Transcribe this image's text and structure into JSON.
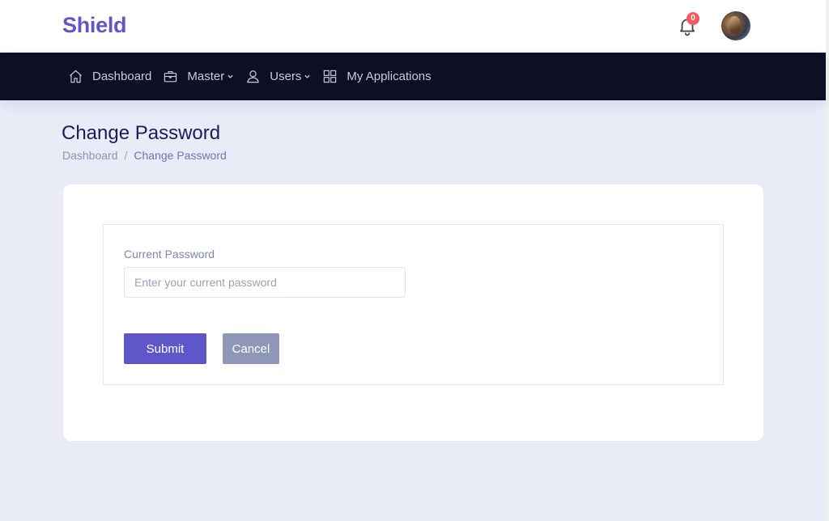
{
  "header": {
    "brand": "Shield",
    "notification_count": "0"
  },
  "nav": {
    "items": [
      {
        "label": "Dashboard",
        "icon": "home-icon",
        "has_dropdown": false
      },
      {
        "label": "Master",
        "icon": "briefcase-icon",
        "has_dropdown": true
      },
      {
        "label": "Users",
        "icon": "user-icon",
        "has_dropdown": true
      },
      {
        "label": "My Applications",
        "icon": "grid-icon",
        "has_dropdown": false
      }
    ]
  },
  "page": {
    "title": "Change Password",
    "breadcrumb": {
      "root": "Dashboard",
      "separator": "/",
      "current": "Change Password"
    }
  },
  "form": {
    "current_password_label": "Current Password",
    "current_password_placeholder": "Enter your current password",
    "current_password_value": "",
    "submit_label": "Submit",
    "cancel_label": "Cancel"
  },
  "colors": {
    "brand": "#5f57c9",
    "navbar": "#0d0f24",
    "page_bg": "#e9ebf7",
    "badge": "#f05a61",
    "cancel": "#8f97b7"
  }
}
